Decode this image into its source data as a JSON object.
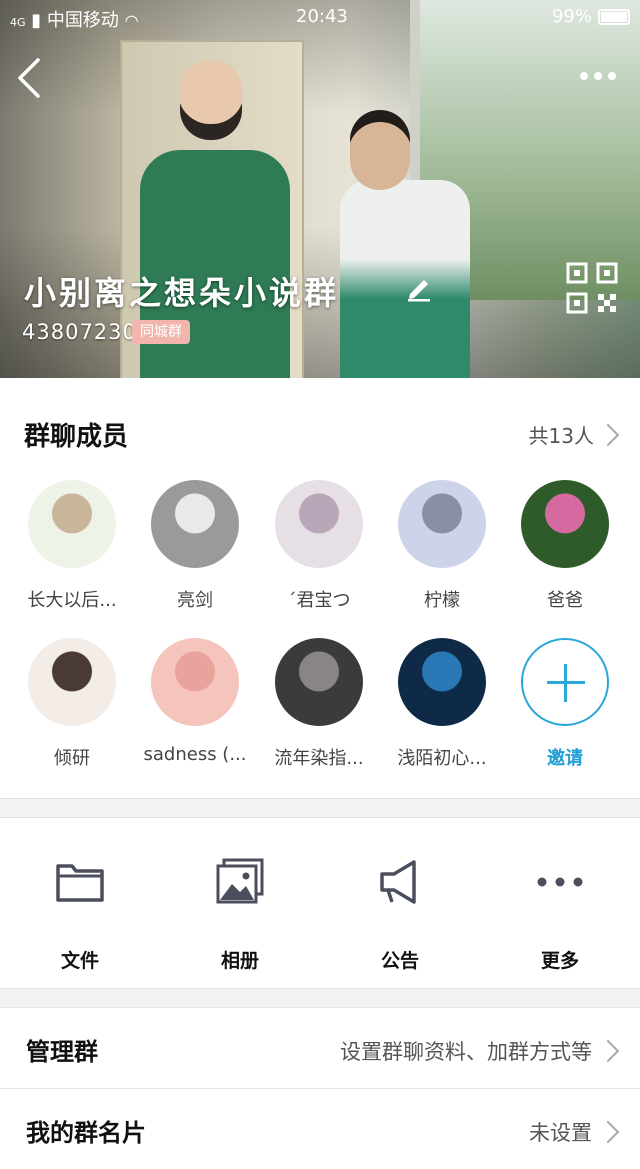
{
  "status_bar": {
    "carrier": "中国移动",
    "network": "4G",
    "time": "20:43",
    "battery": "99%",
    "battery_level": 0.99
  },
  "header": {
    "group_name": "小别离之想朵小说群",
    "group_id": "438072309",
    "badge": "同城群",
    "icons": [
      "back-icon",
      "more-icon",
      "edit-icon",
      "qr-code-icon"
    ]
  },
  "members": {
    "title": "群聊成员",
    "count_label": "共13人",
    "list": [
      {
        "name": "长大以后...",
        "color_a": "#eef3e8",
        "color_b": "#c8b59a"
      },
      {
        "name": "亮剑",
        "color_a": "#9a9a9a",
        "color_b": "#e9e9e9"
      },
      {
        "name": "´君宝つ",
        "color_a": "#e6dfe6",
        "color_b": "#b9a7b9"
      },
      {
        "name": "柠檬",
        "color_a": "#cdd3e8",
        "color_b": "#8a8fa8"
      },
      {
        "name": "爸爸",
        "color_a": "#2f5a2a",
        "color_b": "#d46aa0"
      },
      {
        "name": "倾研",
        "color_a": "#f3ece7",
        "color_b": "#4a3a36"
      },
      {
        "name": "sadness (...",
        "color_a": "#f4c4bd",
        "color_b": "#e8a39c"
      },
      {
        "name": "流年染指...",
        "color_a": "#3b3a3c",
        "color_b": "#8b8486"
      },
      {
        "name": "浅陌初心...",
        "color_a": "#0e2a46",
        "color_b": "#2a78b5"
      }
    ],
    "invite_label": "邀请"
  },
  "actions": [
    {
      "label": "文件",
      "icon": "folder-icon"
    },
    {
      "label": "相册",
      "icon": "photo-album-icon"
    },
    {
      "label": "公告",
      "icon": "megaphone-icon"
    },
    {
      "label": "更多",
      "icon": "more-dots-icon"
    }
  ],
  "settings": [
    {
      "title": "管理群",
      "value": "设置群聊资料、加群方式等"
    },
    {
      "title": "我的群名片",
      "value": "未设置"
    }
  ],
  "colors": {
    "accent": "#2aa7d8",
    "badge": "#f1b5ad",
    "icon_gray": "#4b4e5c"
  }
}
